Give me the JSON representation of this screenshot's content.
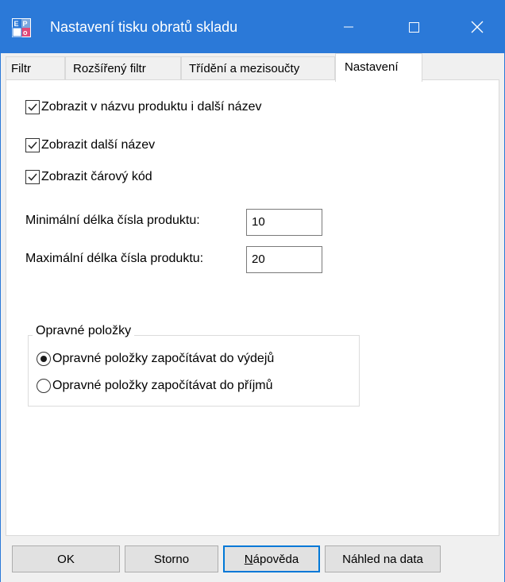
{
  "window": {
    "title": "Nastavení tisku obratů skladu",
    "icon": "app-icon",
    "controls": {
      "minimize_icon": "minimize-icon",
      "maximize_icon": "maximize-icon",
      "close_icon": "close-icon"
    }
  },
  "tabs": [
    {
      "label": "Filtr",
      "active": false
    },
    {
      "label": "Rozšířený filtr",
      "active": false
    },
    {
      "label": "Třídění a mezisoučty",
      "active": false
    },
    {
      "label": "Nastavení",
      "active": true
    }
  ],
  "settings": {
    "checkboxes": [
      {
        "label": "Zobrazit v názvu produktu i další název",
        "checked": true
      },
      {
        "label": "Zobrazit další název",
        "checked": true
      },
      {
        "label": "Zobrazit čárový kód",
        "checked": true
      }
    ],
    "min_length": {
      "label": "Minimální délka čísla produktu:",
      "value": "10"
    },
    "max_length": {
      "label": "Maximální délka čísla produktu:",
      "value": "20"
    },
    "correction_group": {
      "title": "Opravné položky",
      "options": [
        {
          "label": "Opravné položky započítávat do výdejů",
          "selected": true
        },
        {
          "label": "Opravné položky započítávat do příjmů",
          "selected": false
        }
      ]
    }
  },
  "buttons": {
    "ok": "OK",
    "storno": "Storno",
    "help_underlined": "N",
    "help_rest": "ápověda",
    "preview": "Náhled na data"
  },
  "colors": {
    "titlebar": "#2b79d8",
    "accent": "#0078d7"
  }
}
